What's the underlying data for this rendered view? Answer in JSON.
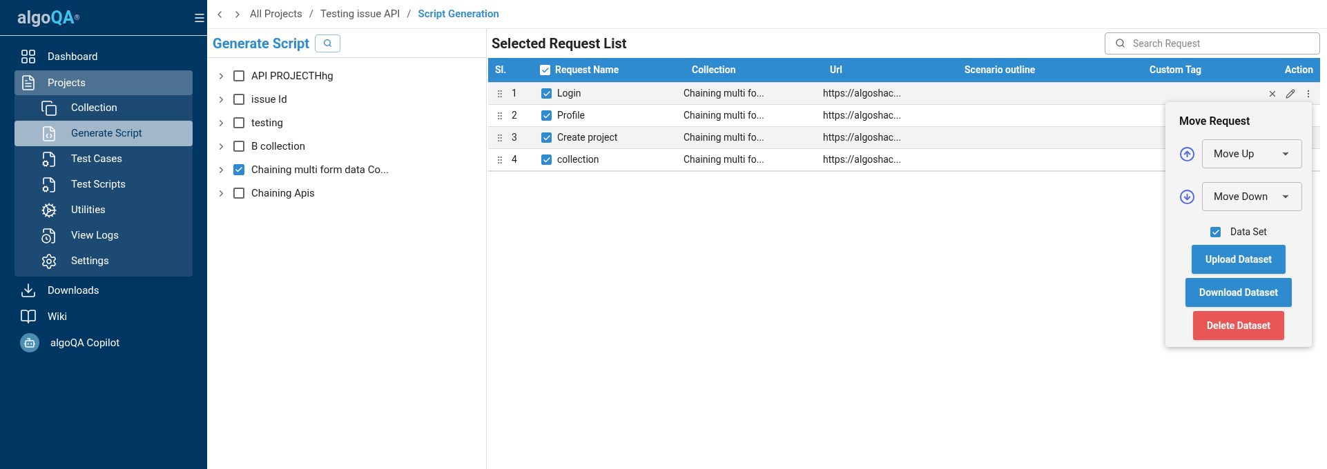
{
  "sidebar": {
    "logo": {
      "main": "algo",
      "accent": "QA",
      "mark": "®"
    },
    "items": [
      {
        "label": "Dashboard",
        "selected": false
      },
      {
        "label": "Projects",
        "selected": true,
        "expanded": true,
        "children": [
          {
            "label": "Collection",
            "selected": false
          },
          {
            "label": "Generate Script",
            "selected": true
          },
          {
            "label": "Test Cases",
            "selected": false
          },
          {
            "label": "Test Scripts",
            "selected": false
          },
          {
            "label": "Utilities",
            "selected": false
          },
          {
            "label": "View Logs",
            "selected": false
          },
          {
            "label": "Settings",
            "selected": false
          }
        ]
      },
      {
        "label": "Downloads",
        "selected": false
      },
      {
        "label": "Wiki",
        "selected": false
      },
      {
        "label": "algoQA Copilot",
        "selected": false
      }
    ]
  },
  "breadcrumb": {
    "separator": "/",
    "items": [
      "All Projects",
      "Testing issue API",
      "Script Generation"
    ]
  },
  "tree_panel": {
    "title": "Generate Script",
    "items": [
      {
        "label": "API PROJECTHhg",
        "checked": false
      },
      {
        "label": "issue Id",
        "checked": false
      },
      {
        "label": "testing",
        "checked": false
      },
      {
        "label": "B collection",
        "checked": false
      },
      {
        "label": "Chaining multi form data Co...",
        "checked": true
      },
      {
        "label": "Chaining Apis",
        "checked": false
      }
    ]
  },
  "request_panel": {
    "title": "Selected Request List",
    "search": {
      "placeholder": "Search Request"
    },
    "table": {
      "select_all_checked": true,
      "columns": [
        "Sl.",
        "Request Name",
        "Collection",
        "Url",
        "Scenario outline",
        "Custom Tag",
        "Action"
      ],
      "rows": [
        {
          "sl": "1",
          "checked": true,
          "name": "Login",
          "collection": "Chaining multi fo...",
          "url": "https://algoshac...",
          "hovered": true
        },
        {
          "sl": "2",
          "checked": true,
          "name": "Profile",
          "collection": "Chaining multi fo...",
          "url": "https://algoshac...",
          "hovered": false
        },
        {
          "sl": "3",
          "checked": true,
          "name": "Create project",
          "collection": "Chaining multi fo...",
          "url": "https://algoshac...",
          "hovered": false
        },
        {
          "sl": "4",
          "checked": true,
          "name": "collection",
          "collection": "Chaining multi fo...",
          "url": "https://algoshac...",
          "hovered": false
        }
      ]
    }
  },
  "move_popover": {
    "title": "Move Request",
    "move_up": "Move Up",
    "move_down": "Move Down",
    "data_set": {
      "label": "Data Set",
      "checked": true
    },
    "buttons": [
      {
        "label": "Upload Dataset",
        "kind": "primary"
      },
      {
        "label": "Download Dataset",
        "kind": "primary"
      },
      {
        "label": "Delete Dataset",
        "kind": "danger"
      }
    ]
  }
}
